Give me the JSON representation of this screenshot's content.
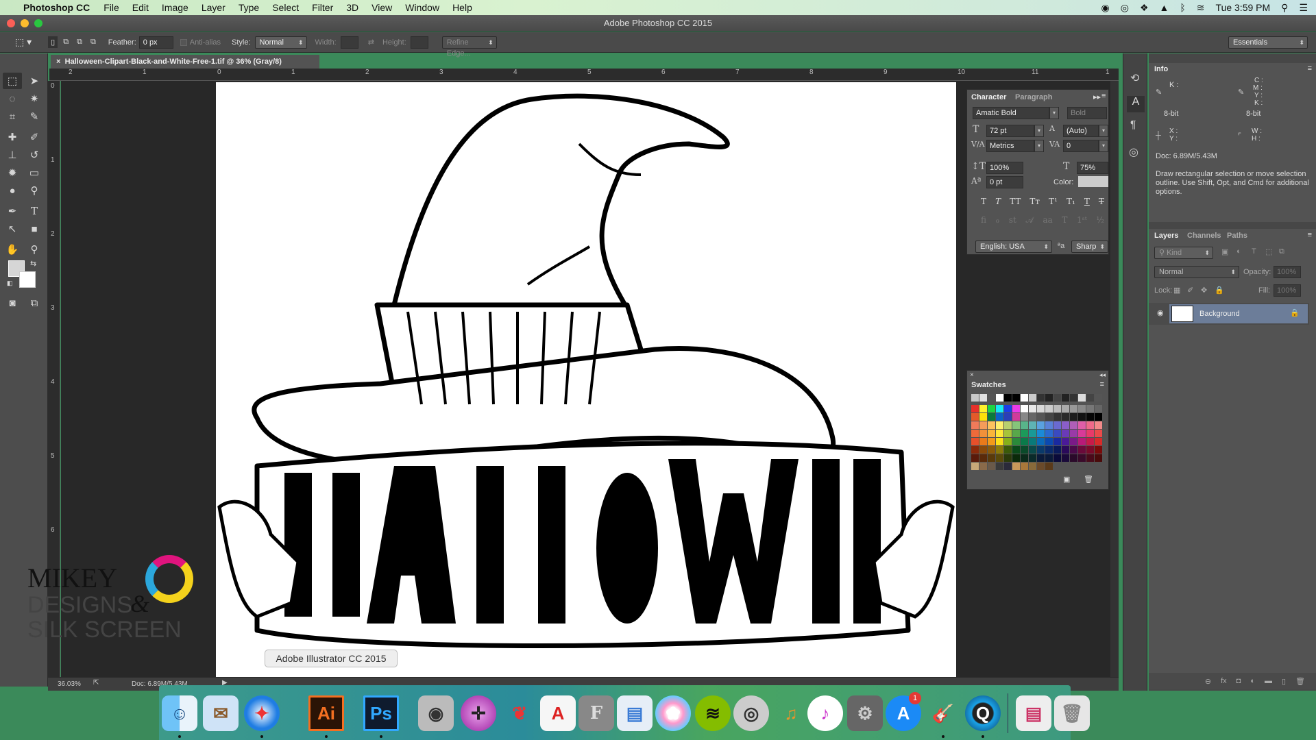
{
  "menubar": {
    "app": "Photoshop CC",
    "items": [
      "File",
      "Edit",
      "Image",
      "Layer",
      "Type",
      "Select",
      "Filter",
      "3D",
      "View",
      "Window",
      "Help"
    ],
    "clock": "Tue 3:59 PM"
  },
  "window": {
    "title": "Adobe Photoshop CC 2015"
  },
  "options": {
    "feather_label": "Feather:",
    "feather_value": "0 px",
    "antialias_label": "Anti-alias",
    "style_label": "Style:",
    "style_value": "Normal",
    "width_label": "Width:",
    "height_label": "Height:",
    "refine_edge": "Refine Edge...",
    "workspace": "Essentials"
  },
  "document": {
    "tab_title": "Halloween-Clipart-Black-and-White-Free-1.tif @ 36% (Gray/8)",
    "zoom": "36.03%",
    "doc_size": "Doc: 6.89M/5.43M"
  },
  "rulers": {
    "h": [
      "2",
      "1",
      "0",
      "1",
      "2",
      "3",
      "4",
      "5",
      "6",
      "7",
      "8",
      "9",
      "10",
      "11",
      "1"
    ],
    "v": [
      "0",
      "1",
      "2",
      "3",
      "4",
      "5",
      "6"
    ]
  },
  "character": {
    "tabs": [
      "Character",
      "Paragraph"
    ],
    "font_family": "Amatic Bold",
    "font_style": "Bold",
    "size": "72 pt",
    "leading": "(Auto)",
    "kerning": "Metrics",
    "tracking": "0",
    "vscale": "100%",
    "hscale": "75%",
    "baseline": "0 pt",
    "color_label": "Color:",
    "language": "English: USA",
    "antialias": "Sharp",
    "aa_glyph": "ªa"
  },
  "info": {
    "title": "Info",
    "k": "K :",
    "cmyk": [
      "C :",
      "M :",
      "Y :",
      "K :"
    ],
    "bit1": "8-bit",
    "bit2": "8-bit",
    "xy": [
      "X :",
      "Y :"
    ],
    "wh": [
      "W :",
      "H :"
    ],
    "doc": "Doc: 6.89M/5.43M",
    "hint": "Draw rectangular selection or move selection outline.  Use Shift, Opt, and Cmd for additional options."
  },
  "layers": {
    "tabs": [
      "Layers",
      "Channels",
      "Paths"
    ],
    "filter": "Kind",
    "blend": "Normal",
    "opacity_label": "Opacity:",
    "opacity": "100%",
    "lock_label": "Lock:",
    "fill_label": "Fill:",
    "fill": "100%",
    "items": [
      {
        "name": "Background",
        "locked": true,
        "visible": true
      }
    ]
  },
  "swatches": {
    "title": "Swatches"
  },
  "dock": {
    "tooltip": "Adobe Illustrator CC 2015",
    "badge": "1"
  },
  "watermark": {
    "line1": "MIKEY",
    "line2": "DESIGNS",
    "amp": "&",
    "line3": "SILK SCREEN"
  }
}
